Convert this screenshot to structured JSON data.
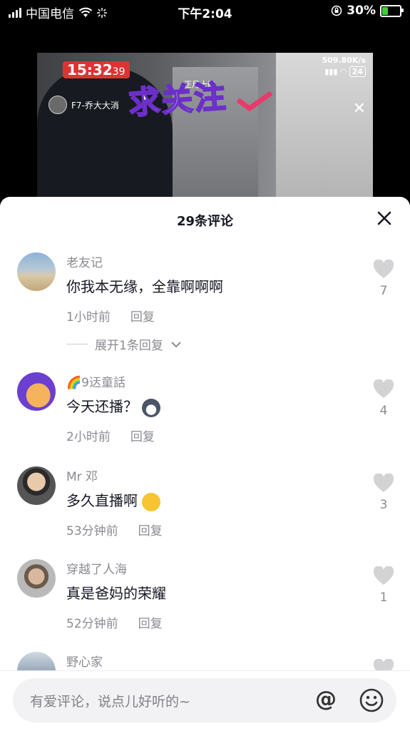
{
  "status_bar": {
    "carrier": "中国电信",
    "time": "下午2:04",
    "battery": "30%",
    "battery_level": 0.3
  },
  "video": {
    "clock_time": "15:32",
    "clock_seconds": "39",
    "speed": "509.80K/s",
    "signal_badge": "24",
    "date_text": "正月十四",
    "anchor_name": "F7-乔大大消",
    "sticker_text": "求关注"
  },
  "sheet": {
    "title": "29条评论",
    "expand_label": "展开1条回复"
  },
  "comments": [
    {
      "name": "老友记",
      "text": "你我本无缘，全靠啊啊啊",
      "time": "1小时前",
      "reply": "回复",
      "likes": "7"
    },
    {
      "name": "🌈9迗童話",
      "text": "今天还播？",
      "time": "2小时前",
      "reply": "回复",
      "likes": "4"
    },
    {
      "name": "Mr 邓",
      "text": "多久直播啊",
      "time": "53分钟前",
      "reply": "回复",
      "likes": "3"
    },
    {
      "name": "穿越了人海",
      "text": "真是爸妈的荣耀",
      "time": "52分钟前",
      "reply": "回复",
      "likes": "1"
    },
    {
      "name": "野心家",
      "text": "",
      "time": "",
      "reply": "",
      "likes": ""
    }
  ],
  "input": {
    "placeholder": "有爱评论，说点儿好听的~",
    "at_symbol": "@"
  },
  "colors": {
    "accent_text": "#161823",
    "secondary_text": "#8a8b91",
    "battery_green": "#3ad13a"
  }
}
